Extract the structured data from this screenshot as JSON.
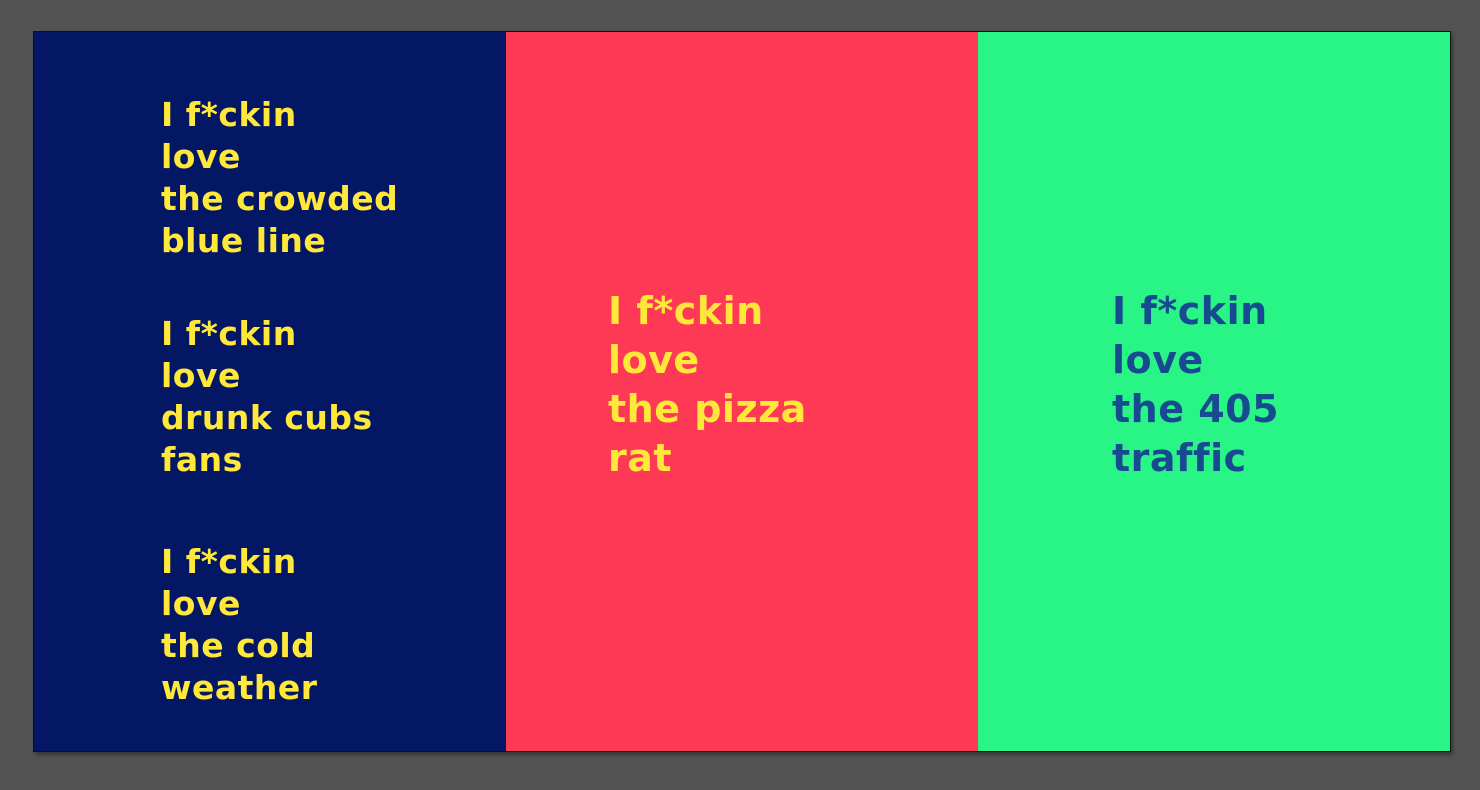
{
  "colors": {
    "canvas_background": "#535353",
    "left_panel": "#031764",
    "middle_panel": "#fe3955",
    "right_panel": "#29f486",
    "yellow_text": "#ffe83a",
    "blue_text": "#174a91"
  },
  "panels": {
    "left": {
      "blocks": [
        {
          "lines": [
            "I f*ckin",
            "love",
            "the crowded",
            "blue line"
          ]
        },
        {
          "lines": [
            "I f*ckin",
            "love",
            "drunk cubs",
            "fans"
          ]
        },
        {
          "lines": [
            "I f*ckin",
            "love",
            "the cold",
            "weather"
          ]
        }
      ]
    },
    "middle": {
      "lines": [
        "I f*ckin",
        "love",
        "the pizza",
        "rat"
      ]
    },
    "right": {
      "lines": [
        "I f*ckin",
        "love",
        "the 405",
        "traffic"
      ]
    }
  }
}
